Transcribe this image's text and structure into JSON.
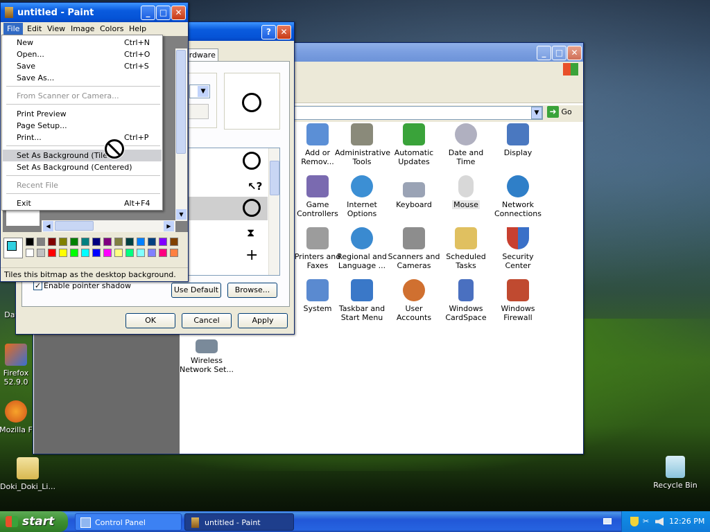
{
  "desktop": {
    "icons": [
      {
        "label": "Dat"
      },
      {
        "label": "Firefox 52.9.0"
      },
      {
        "label": "Mozilla F"
      },
      {
        "label": "Doki_Doki_Li..."
      },
      {
        "label": "Recycle Bin"
      }
    ]
  },
  "control_panel": {
    "go_label": "Go",
    "items": [
      {
        "label": "Add or Remov...",
        "color": "#5b8fd6"
      },
      {
        "label": "Administrative Tools",
        "color": "#8a8a7a"
      },
      {
        "label": "Automatic Updates",
        "color": "#3aa33a"
      },
      {
        "label": "Date and Time",
        "color": "#b0b0c0"
      },
      {
        "label": "Display",
        "color": "#4a78c0"
      },
      {
        "label": "Game Controllers",
        "color": "#7a6ab0"
      },
      {
        "label": "Internet Options",
        "color": "#3c8fd4"
      },
      {
        "label": "Keyboard",
        "color": "#9aa3b5"
      },
      {
        "label": "Mouse",
        "color": "#d8d8d8"
      },
      {
        "label": "Network Connections",
        "color": "#2f7fc8"
      },
      {
        "label": "Printers and Faxes",
        "color": "#9c9c9c"
      },
      {
        "label": "Regional and Language ...",
        "color": "#3a8ad0"
      },
      {
        "label": "Scanners and Cameras",
        "color": "#8d8d8d"
      },
      {
        "label": "Scheduled Tasks",
        "color": "#e0c060"
      },
      {
        "label": "Security Center",
        "color": "#c84030"
      },
      {
        "label": "System",
        "color": "#5a8ad0"
      },
      {
        "label": "Taskbar and Start Menu",
        "color": "#3a78c8"
      },
      {
        "label": "User Accounts",
        "color": "#d07030"
      },
      {
        "label": "Windows CardSpace",
        "color": "#4a70c0"
      },
      {
        "label": "Windows Firewall",
        "color": "#c04a30"
      },
      {
        "label": "Wireless Network Set...",
        "color": "#7a8a9a"
      }
    ]
  },
  "mouse_dialog": {
    "tab_hardware": "ardware",
    "enable_shadow": "Enable pointer shadow",
    "use_default": "Use Default",
    "browse": "Browse...",
    "ok": "OK",
    "cancel": "Cancel",
    "apply": "Apply",
    "help_glyph": "?",
    "close_glyph": "✕"
  },
  "paint": {
    "title": "untitled - Paint",
    "menubar": [
      "File",
      "Edit",
      "View",
      "Image",
      "Colors",
      "Help"
    ],
    "file_menu": [
      {
        "label": "New",
        "shortcut": "Ctrl+N"
      },
      {
        "label": "Open...",
        "shortcut": "Ctrl+O"
      },
      {
        "label": "Save",
        "shortcut": "Ctrl+S"
      },
      {
        "label": "Save As...",
        "shortcut": ""
      },
      {
        "label": "From Scanner or Camera...",
        "shortcut": ""
      },
      {
        "label": "Print Preview",
        "shortcut": ""
      },
      {
        "label": "Page Setup...",
        "shortcut": ""
      },
      {
        "label": "Print...",
        "shortcut": "Ctrl+P"
      },
      {
        "label": "Set As Background (Tiled)",
        "shortcut": ""
      },
      {
        "label": "Set As Background (Centered)",
        "shortcut": ""
      },
      {
        "label": "Recent File",
        "shortcut": ""
      },
      {
        "label": "Exit",
        "shortcut": "Alt+F4"
      }
    ],
    "status": "Tiles this bitmap as the desktop background.",
    "palette_colors": [
      "#000000",
      "#808080",
      "#800000",
      "#808000",
      "#008000",
      "#008080",
      "#000080",
      "#800080",
      "#808040",
      "#004040",
      "#0080ff",
      "#004080",
      "#8000ff",
      "#804000",
      "#ffffff",
      "#c0c0c0",
      "#ff0000",
      "#ffff00",
      "#00ff00",
      "#00ffff",
      "#0000ff",
      "#ff00ff",
      "#ffff80",
      "#00ff80",
      "#80ffff",
      "#8080ff",
      "#ff0080",
      "#ff8040"
    ]
  },
  "taskbar": {
    "start": "start",
    "tasks": [
      "Control Panel",
      "untitled - Paint"
    ],
    "clock": "12:26 PM"
  }
}
